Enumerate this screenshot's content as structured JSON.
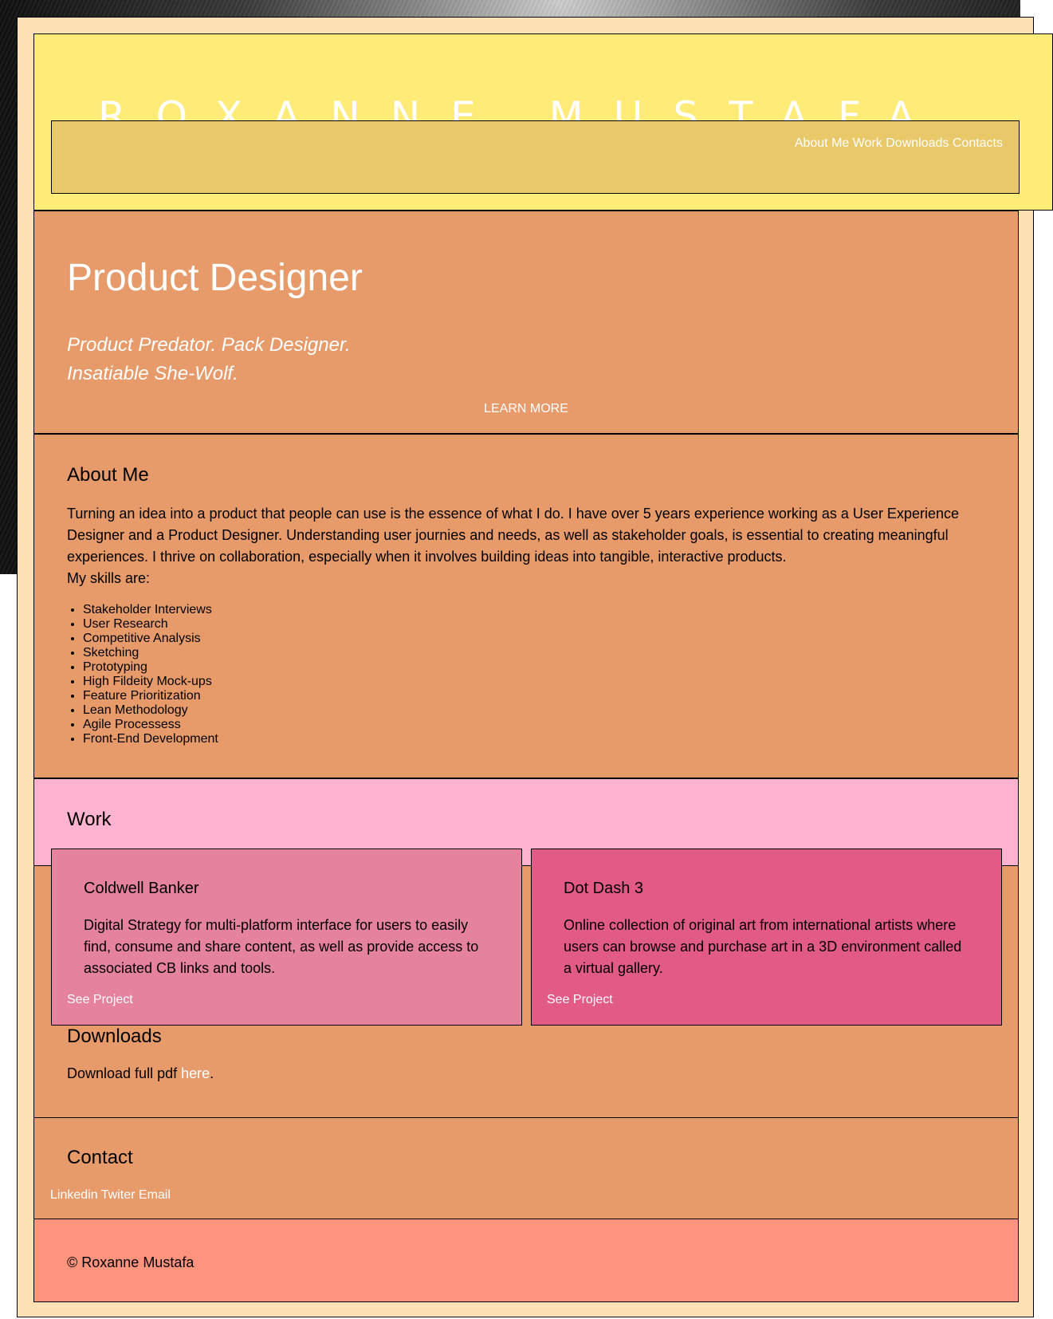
{
  "header": {
    "title": "ROXANNE MUSTAFA",
    "nav": [
      "About Me",
      "Work",
      "Downloads",
      "Contacts"
    ]
  },
  "hero": {
    "heading": "Product Designer",
    "tagline_line1": "Product Predator. Pack Designer.",
    "tagline_line2": "Insatiable She-Wolf.",
    "cta": "LEARN MORE"
  },
  "about": {
    "heading": "About Me",
    "paragraph": "Turning an idea into a product that people can use is the essence of what I do. I have over 5 years experience working as a User Experience Designer and a Product Designer. Understanding user journies and needs, as well as stakeholder goals, is essential to creating meaningful experiences. I thrive on collaboration, especially when it involves building ideas into tangible, interactive products.",
    "skills_intro": "My skills are:",
    "skills": [
      "Stakeholder Interviews",
      "User Research",
      "Competitive Analysis",
      "Sketching",
      "Prototyping",
      "High Fildeity Mock-ups",
      "Feature Prioritization",
      "Lean Methodology",
      "Agile Processess",
      "Front-End Development"
    ]
  },
  "work": {
    "heading": "Work",
    "projects": [
      {
        "title": "Coldwell Banker",
        "description": "Digital Strategy for multi-platform interface for users to easily find, consume and share content, as well as provide access to associated CB links and tools.",
        "link": "See Project"
      },
      {
        "title": "Dot Dash 3",
        "description": "Online collection of original art from international artists where users can browse and purchase art in a 3D environment called a virtual gallery.",
        "link": "See Project"
      }
    ]
  },
  "downloads": {
    "heading": "Downloads",
    "text": "Download full pdf ",
    "link": "here",
    "suffix": "."
  },
  "contact": {
    "heading": "Contact",
    "links": [
      "Linkedin",
      "Twiter",
      "Email"
    ]
  },
  "footer": {
    "copyright": "© Roxanne Mustafa"
  },
  "colors": {
    "page_bg": "#fee1b4",
    "header": "#ffeb77",
    "nav_bar": "#e9c86a",
    "section": "#e79b6b",
    "work": "#ffb3cf",
    "card1": "#e5829e",
    "card2": "#e25a86",
    "footer": "#ff947e"
  }
}
